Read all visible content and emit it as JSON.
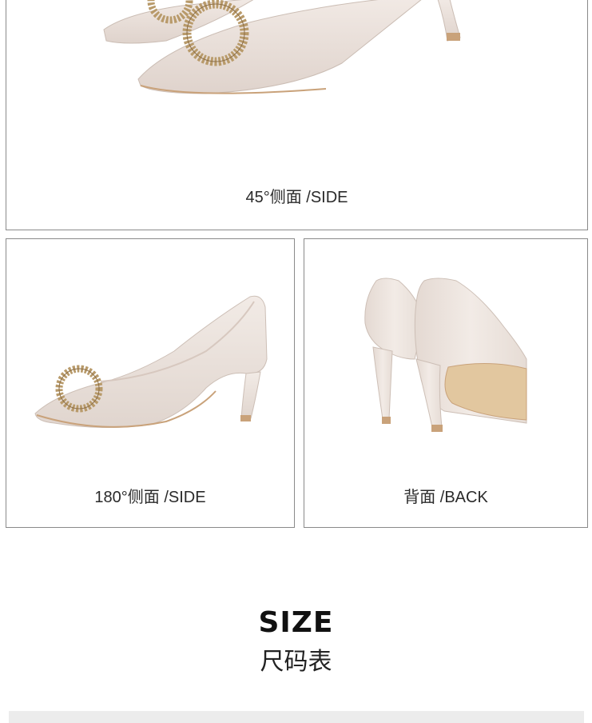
{
  "views": {
    "side_45": {
      "caption": "45°侧面 /SIDE"
    },
    "side_180": {
      "caption": "180°侧面 /SIDE"
    },
    "back": {
      "caption": "背面 /BACK"
    }
  },
  "size_section": {
    "title": "SIZE",
    "subtitle": "尺码表"
  },
  "colors": {
    "shoe_leather": "#ece3de",
    "shoe_shadow": "#d8ccc5",
    "sole_tan": "#c9a27a",
    "buckle_gold": "#b89a6a",
    "border": "#8a8a8a",
    "table_strip": "#ececec"
  }
}
